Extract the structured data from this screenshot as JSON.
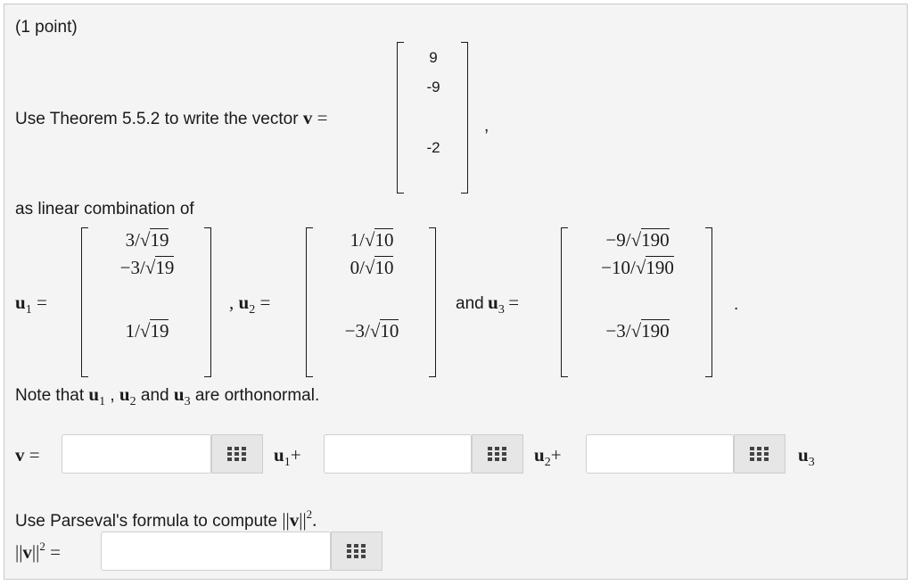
{
  "header": {
    "points": "(1 point)"
  },
  "prompt": {
    "intro": "Use Theorem 5.5.2 to write the vector",
    "v_symbol": "v",
    "equals": "=",
    "comma": ",",
    "v_entries": [
      "9",
      "-9",
      "-2"
    ],
    "combination_text": "as linear combination of",
    "note_prefix": "Note that",
    "note_and": "and",
    "note_suffix": "are orthonormal.",
    "and_text": "and",
    "period": "."
  },
  "basis": {
    "u1": {
      "symbol": "u",
      "index": "1",
      "rows": [
        {
          "num": "3/",
          "rad": "19"
        },
        {
          "num": "−3/",
          "rad": "19"
        },
        {
          "num": "1/",
          "rad": "19"
        }
      ]
    },
    "u2": {
      "symbol": "u",
      "index": "2",
      "rows": [
        {
          "num": "1/",
          "rad": "10"
        },
        {
          "num": "0/",
          "rad": "10"
        },
        {
          "num": "−3/",
          "rad": "10"
        }
      ]
    },
    "u3": {
      "symbol": "u",
      "index": "3",
      "rows": [
        {
          "num": "−9/",
          "rad": "190"
        },
        {
          "num": "−10/",
          "rad": "190"
        },
        {
          "num": "−3/",
          "rad": "190"
        }
      ]
    }
  },
  "answer_row": {
    "lhs": "v =",
    "coef1": "",
    "coef2": "",
    "coef3": "",
    "plus": "+"
  },
  "parseval": {
    "prompt": "Use Parseval's formula to compute",
    "norm_open": "||",
    "norm_v": "v",
    "norm_close": "||",
    "power": "2",
    "period": ".",
    "lhs_equals": "=",
    "answer": ""
  },
  "icons": {
    "keypad": "keypad-grid-icon",
    "sqrt": "radical-sign"
  }
}
